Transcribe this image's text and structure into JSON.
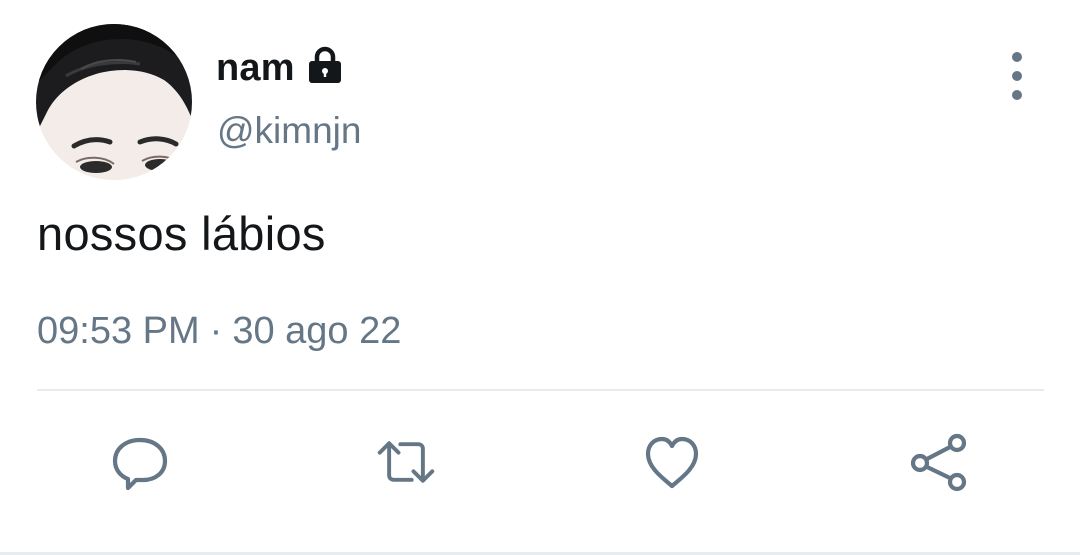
{
  "author": {
    "display_name": "nam",
    "handle": "@kimnjn",
    "protected_icon": "lock-icon"
  },
  "tweet": {
    "text": "nossos lábios",
    "time": "09:53 PM",
    "separator": "·",
    "date": "30 ago 22"
  },
  "actions": [
    {
      "icon": "reply-icon"
    },
    {
      "icon": "retweet-icon"
    },
    {
      "icon": "like-icon"
    },
    {
      "icon": "share-icon"
    }
  ],
  "colors": {
    "text_primary": "#14171a",
    "text_secondary": "#657786",
    "divider": "#e6ecf0"
  }
}
